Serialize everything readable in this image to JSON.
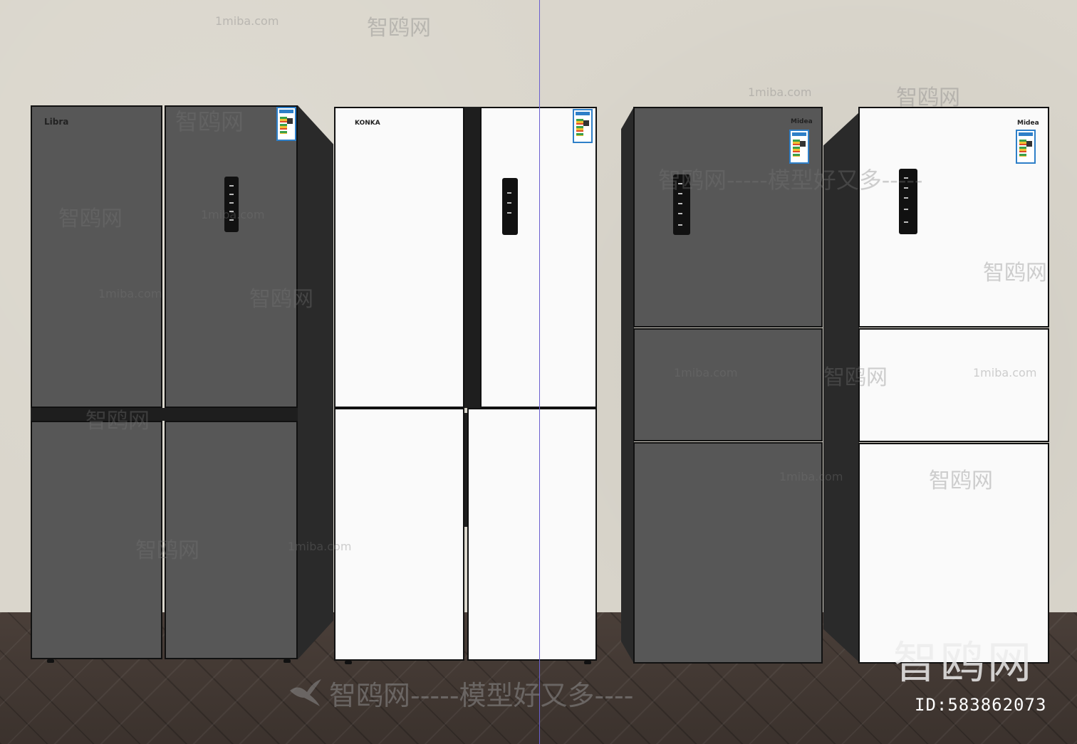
{
  "brands": {
    "fridge1": "Libra",
    "fridge2": "KONKA",
    "fridge3": "Midea",
    "fridge4": "Midea"
  },
  "watermarks": {
    "site": "1miba.com",
    "name": "智鸥网",
    "dashes": "------",
    "slogan": "智鸥网-----模型好又多----",
    "slogan_mid": "智鸥网-----模型好又多-----",
    "bottom_logo": "智鸥网",
    "id_text": "ID:583862073"
  },
  "colors": {
    "wall": "#dad6cc",
    "floor": "#3b322d",
    "gray_panel": "#575757",
    "white_panel": "#fafafa",
    "guide_line": "#6a5fd0",
    "energy_label": "#2e7fc8"
  }
}
